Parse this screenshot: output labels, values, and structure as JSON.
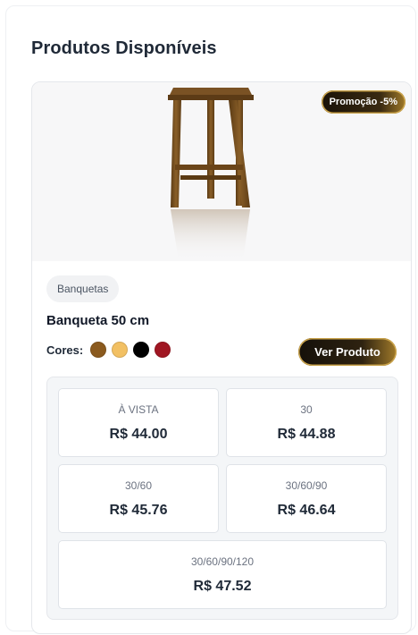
{
  "page": {
    "title": "Produtos Disponíveis"
  },
  "product": {
    "badge": "Promoção -5%",
    "category": "Banquetas",
    "name": "Banqueta 50 cm",
    "colors_label": "Cores:",
    "colors": [
      {
        "name": "brown",
        "hex": "#8B5A1E"
      },
      {
        "name": "mustard",
        "hex": "#F2C063"
      },
      {
        "name": "black",
        "hex": "#000000"
      },
      {
        "name": "red",
        "hex": "#A01622"
      }
    ],
    "view_button": "Ver Produto",
    "prices": [
      {
        "label": "À VISTA",
        "value": "R$ 44.00"
      },
      {
        "label": "30",
        "value": "R$ 44.88"
      },
      {
        "label": "30/60",
        "value": "R$ 45.76"
      },
      {
        "label": "30/60/90",
        "value": "R$ 46.64"
      },
      {
        "label": "30/60/90/120",
        "value": "R$ 47.52"
      }
    ]
  }
}
